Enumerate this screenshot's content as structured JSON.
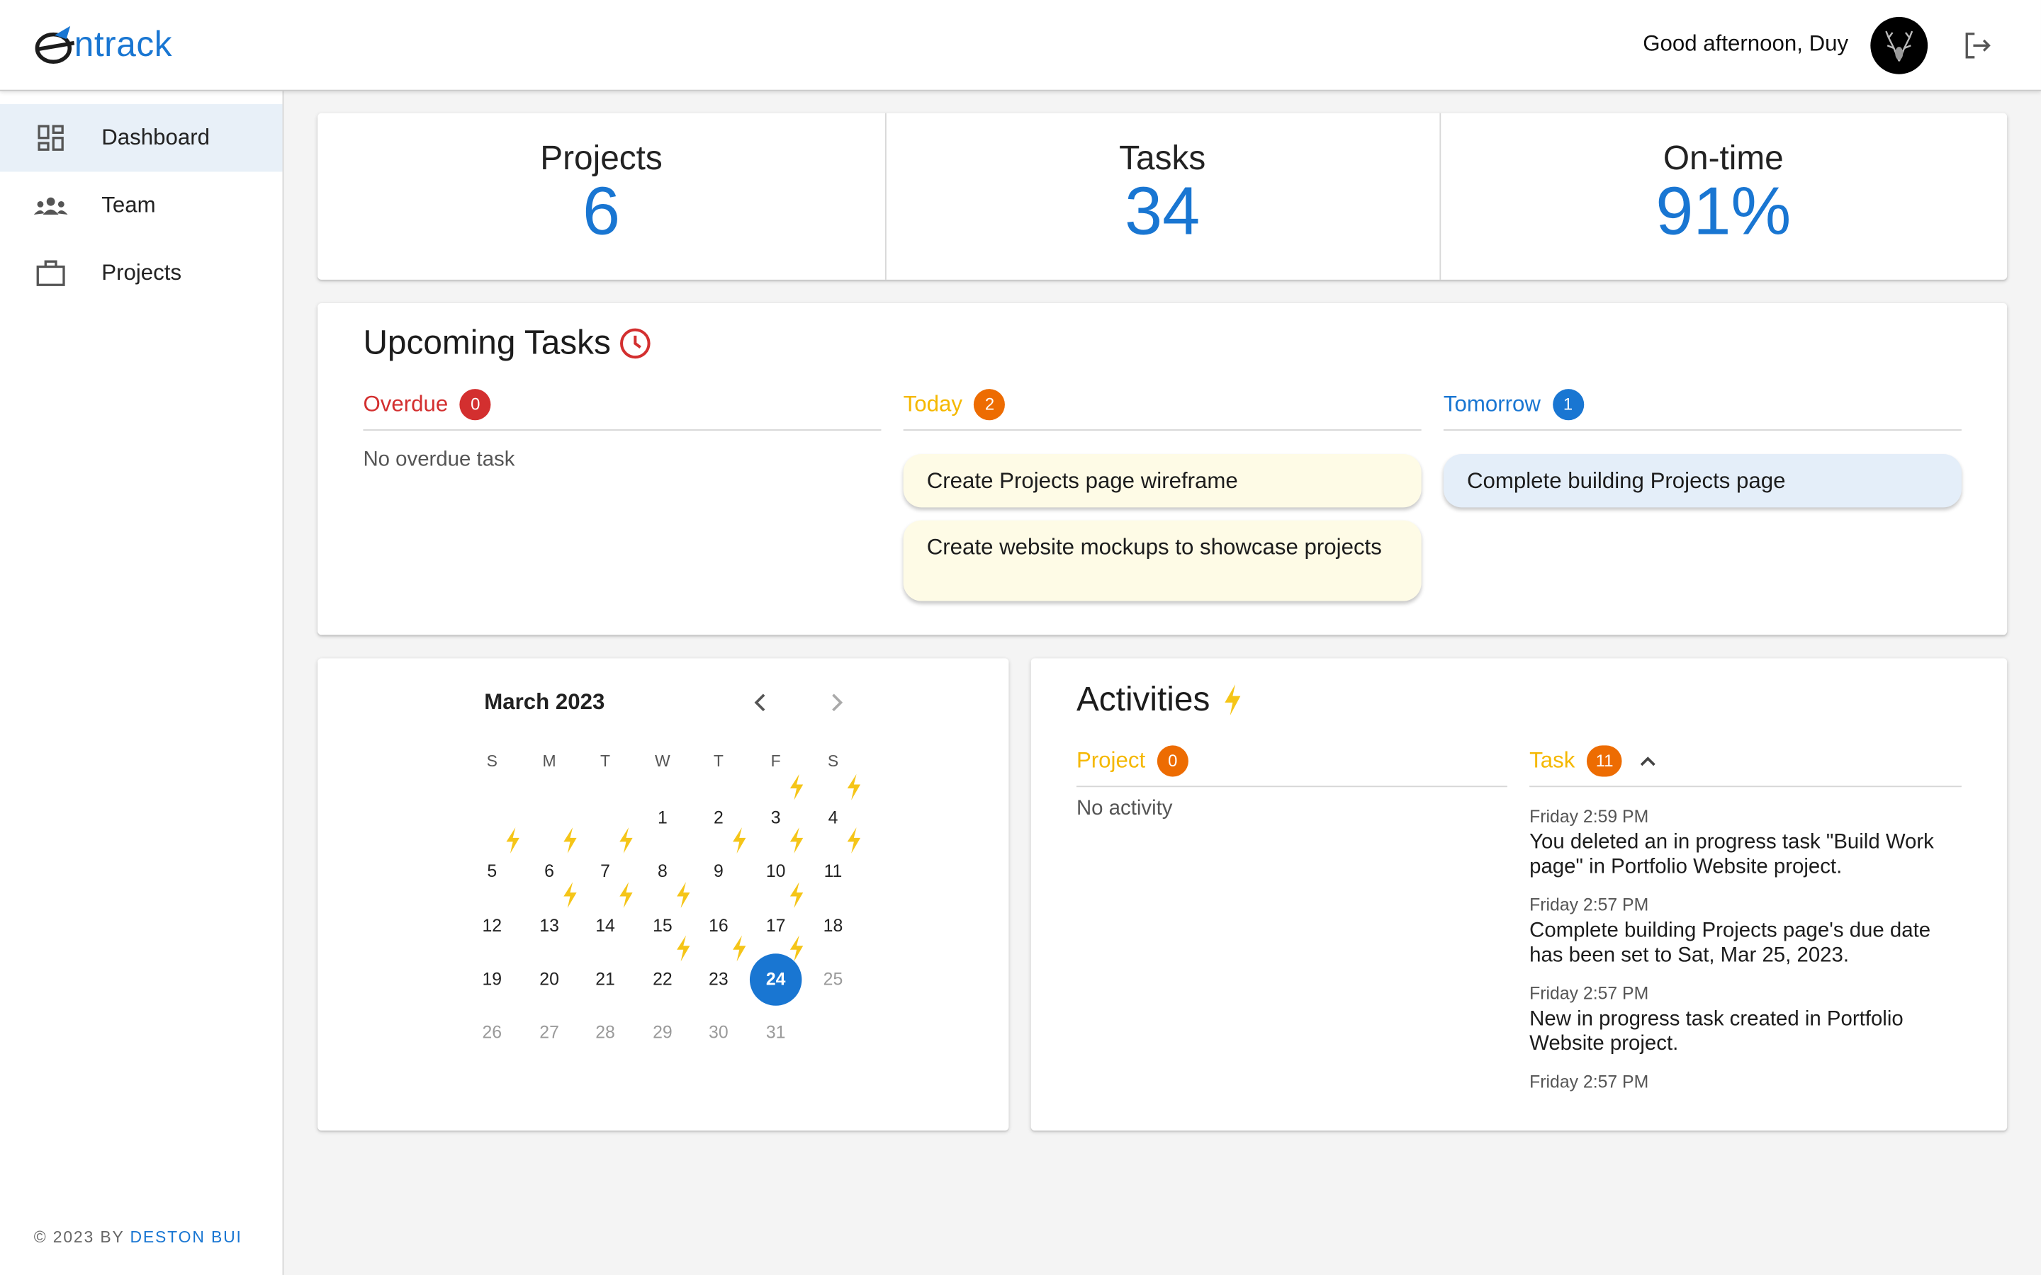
{
  "header": {
    "logo_text": "ntrack",
    "greeting": "Good afternoon, Duy",
    "accent": "#1976d2"
  },
  "sidebar": {
    "items": [
      {
        "label": "Dashboard",
        "icon": "dashboard-icon",
        "active": true
      },
      {
        "label": "Team",
        "icon": "team-icon",
        "active": false
      },
      {
        "label": "Projects",
        "icon": "briefcase-icon",
        "active": false
      }
    ],
    "footer_prefix": "© 2023 BY ",
    "footer_author": "DESTON BUI"
  },
  "stats": [
    {
      "label": "Projects",
      "value": "6"
    },
    {
      "label": "Tasks",
      "value": "34"
    },
    {
      "label": "On-time",
      "value": "91%"
    }
  ],
  "upcoming": {
    "title": "Upcoming Tasks",
    "overdue": {
      "label": "Overdue",
      "count": "0",
      "empty_text": "No overdue task",
      "color": "#d32f2f"
    },
    "today": {
      "label": "Today",
      "count": "2",
      "color": "#f5b800",
      "badge_color": "#ed6c02",
      "tasks": [
        "Create Projects page wireframe",
        "Create website mockups to showcase projects"
      ]
    },
    "tomorrow": {
      "label": "Tomorrow",
      "count": "1",
      "color": "#1976d2",
      "tasks": [
        "Complete building Projects page"
      ]
    }
  },
  "calendar": {
    "month_label": "March 2023",
    "weekdays": [
      "S",
      "M",
      "T",
      "W",
      "T",
      "F",
      "S"
    ],
    "selected_day": "24",
    "days": [
      "1",
      "2",
      "3",
      "4",
      "5",
      "6",
      "7",
      "8",
      "9",
      "10",
      "11",
      "12",
      "13",
      "14",
      "15",
      "16",
      "17",
      "18",
      "19",
      "20",
      "21",
      "22",
      "23",
      "24",
      "25",
      "26",
      "27",
      "28",
      "29",
      "30",
      "31"
    ],
    "days_with_activity": [
      "3",
      "4",
      "5",
      "6",
      "7",
      "9",
      "10",
      "11",
      "13",
      "14",
      "15",
      "17",
      "22",
      "23",
      "24"
    ]
  },
  "activities": {
    "title": "Activities",
    "project": {
      "label": "Project",
      "count": "0",
      "empty_text": "No activity"
    },
    "task": {
      "label": "Task",
      "count": "11",
      "entries": [
        {
          "time": "Friday 2:59 PM",
          "text": "You deleted an in progress task \"Build Work page\" in Portfolio Website project."
        },
        {
          "time": "Friday 2:57 PM",
          "text": "Complete building Projects page's due date has been set to Sat, Mar 25, 2023."
        },
        {
          "time": "Friday 2:57 PM",
          "text": "New in progress task created in Portfolio Website project."
        },
        {
          "time": "Friday 2:57 PM",
          "text": ""
        }
      ]
    }
  }
}
